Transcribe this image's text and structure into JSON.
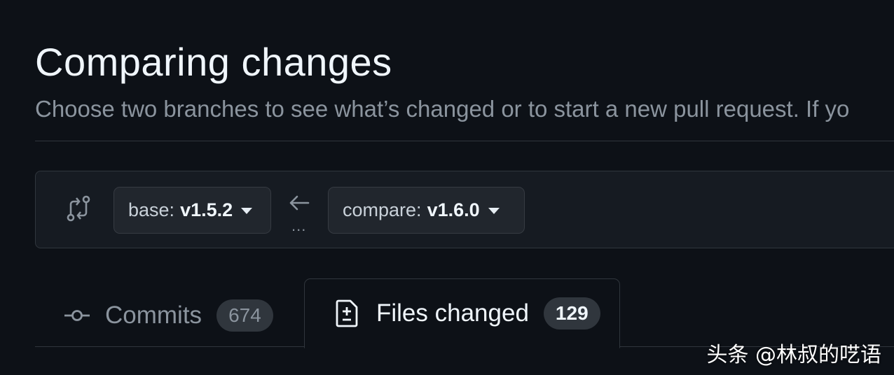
{
  "header": {
    "title": "Comparing changes",
    "subtitle": "Choose two branches to see what’s changed or to start a new pull request. If yo"
  },
  "range": {
    "compare_icon": "git-compare-icon",
    "base": {
      "label": "base:",
      "value": "v1.5.2"
    },
    "arrow_icon": "arrow-left-icon",
    "dots": "...",
    "compare": {
      "label": "compare:",
      "value": "v1.6.0"
    }
  },
  "tabs": [
    {
      "label": "Commits",
      "count": "674",
      "icon": "git-commit-icon",
      "selected": false
    },
    {
      "label": "Files changed",
      "count": "129",
      "icon": "file-diff-icon",
      "selected": true
    }
  ],
  "watermark": "头条 @林叔的呓语",
  "colors": {
    "background": "#0d1117",
    "panel": "#161b22",
    "border": "#30363d",
    "muted_text": "#8b949e",
    "text": "#f0f6fc"
  }
}
